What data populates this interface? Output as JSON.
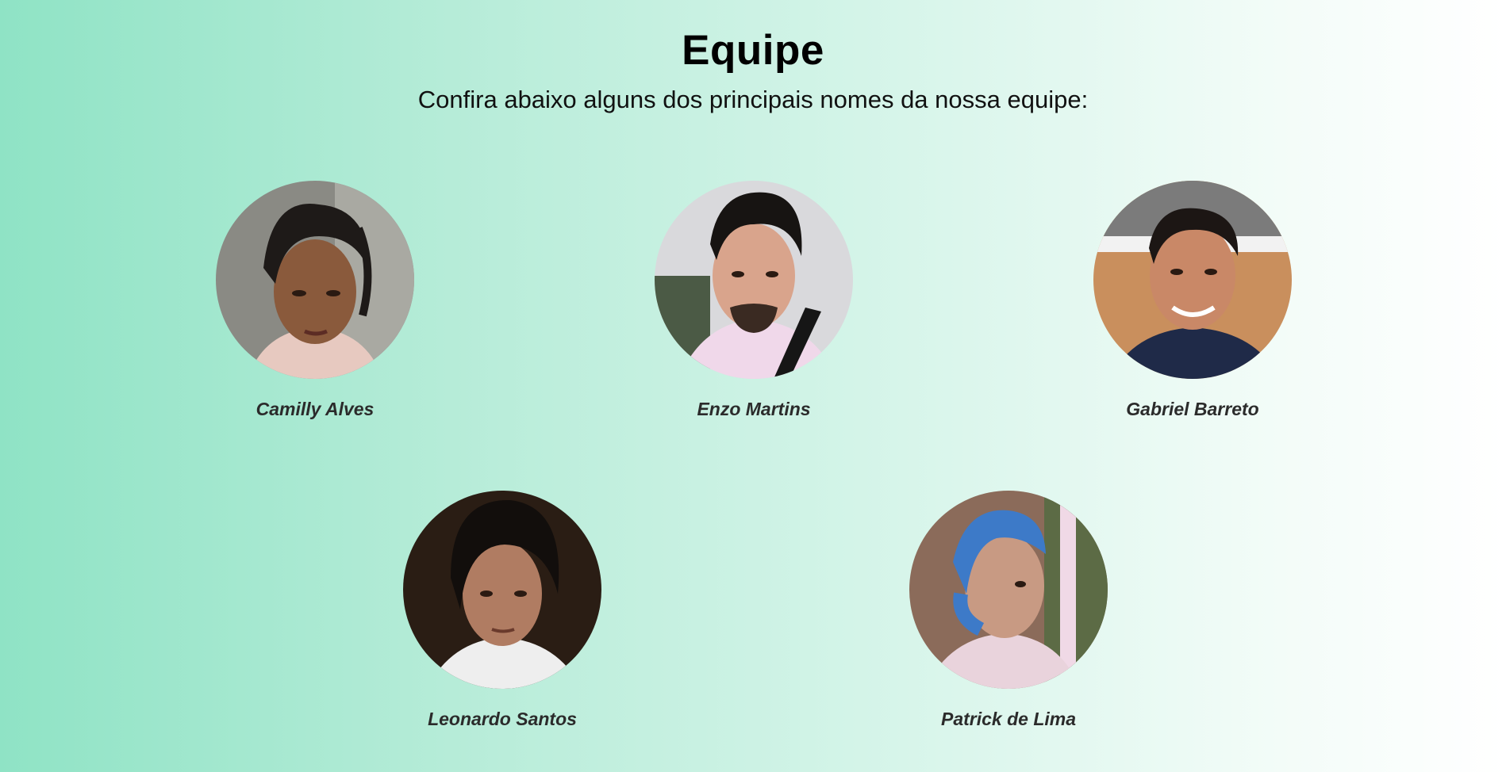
{
  "section": {
    "title": "Equipe",
    "subtitle": "Confira abaixo alguns dos principais nomes da nossa equipe:"
  },
  "members": [
    {
      "name": "Camilly Alves",
      "photo": "camilly-photo"
    },
    {
      "name": "Enzo Martins",
      "photo": "enzo-photo"
    },
    {
      "name": "Gabriel Barreto",
      "photo": "gabriel-photo"
    },
    {
      "name": "Leonardo Santos",
      "photo": "leonardo-photo"
    },
    {
      "name": "Patrick de Lima",
      "photo": "patrick-photo"
    }
  ],
  "colors": {
    "gradient_left": "#8fe3c5",
    "gradient_right": "#ffffff",
    "name_text": "#2b2b2b"
  }
}
